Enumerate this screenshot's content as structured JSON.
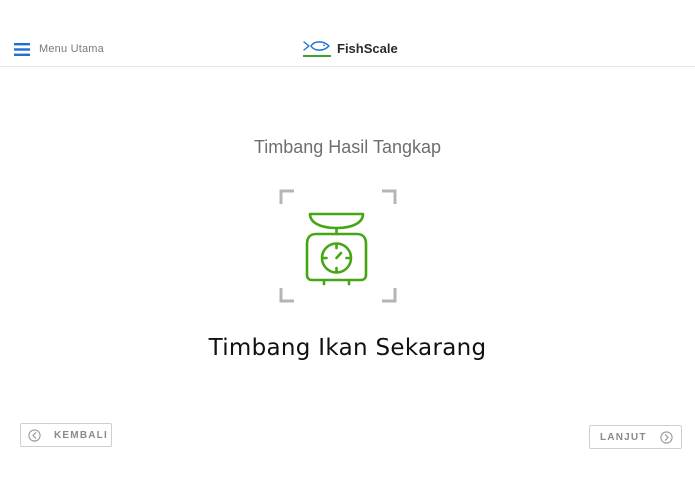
{
  "header": {
    "menu_label": "Menu Utama",
    "brand_name": "FishScale",
    "accent_color": "#1f6fd6",
    "brand_green": "#3fa12c"
  },
  "main": {
    "subtitle": "Timbang Hasil Tangkap",
    "action_title": "Timbang Ikan Sekarang",
    "icon": "weighing-scale-icon",
    "icon_color": "#45a614"
  },
  "footer": {
    "back_label": "KEMBALI",
    "next_label": "LANJUT"
  }
}
